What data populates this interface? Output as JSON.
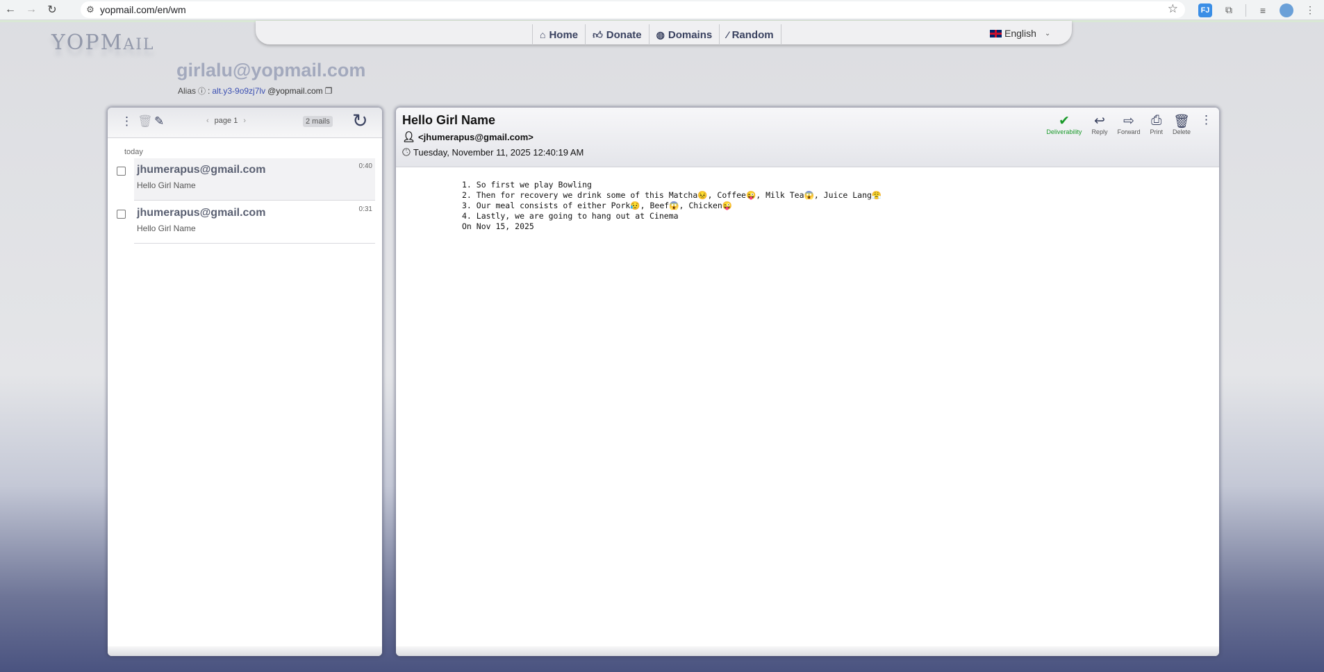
{
  "browser": {
    "url": "yopmail.com/en/wm",
    "ext_fj": "FJ"
  },
  "nav": {
    "home": "Home",
    "donate": "Donate",
    "domains": "Domains",
    "random": "Random",
    "language": "English"
  },
  "logo": {
    "main": "YOPM",
    "tail": "AIL"
  },
  "inbox": {
    "address": "girlalu@yopmail.com",
    "alias_label": "Alias",
    "alias_prefix": "alt.y3-9o9zj7lv",
    "alias_domain": "@yopmail.com"
  },
  "list": {
    "page_label": "page 1",
    "count": "2 mails",
    "day_label": "today",
    "mails": [
      {
        "from": "jhumerapus@gmail.com",
        "subject": "Hello Girl Name",
        "time": "0:40"
      },
      {
        "from": "jhumerapus@gmail.com",
        "subject": "Hello Girl Name",
        "time": "0:31"
      }
    ]
  },
  "message": {
    "subject": "Hello Girl Name",
    "sender": "<jhumerapus@gmail.com>",
    "date": "Tuesday, November 11, 2025 12:40:19 AM",
    "actions": {
      "deliverability": "Deliverability",
      "reply": "Reply",
      "forward": "Forward",
      "print": "Print",
      "delete": "Delete"
    },
    "body_lines": [
      "1. So first we play Bowling",
      "2. Then for recovery we drink some of this Matcha😣, Coffee😜, Milk Tea😱, Juice Lang😤",
      "3. Our meal consists of either Pork😥, Beef😱, Chicken😜",
      "4. Lastly, we are going to hang out at Cinema",
      "On Nov 15, 2025"
    ]
  }
}
